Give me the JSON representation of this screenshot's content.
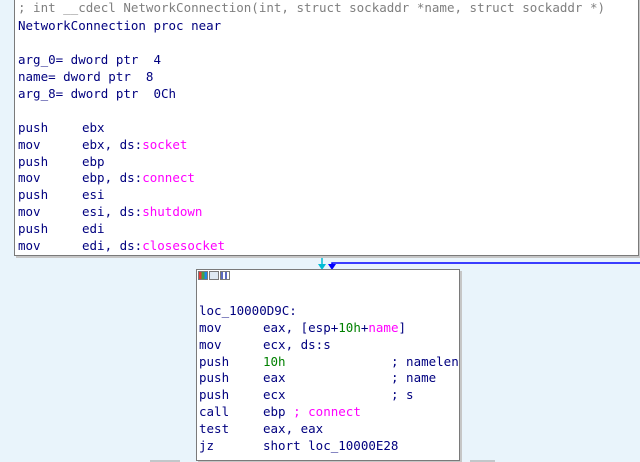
{
  "top_block": {
    "header_comment": "; int __cdecl NetworkConnection(int, struct sockaddr *name, struct sockaddr *)",
    "proc_line": "NetworkConnection proc near",
    "args": [
      "arg_0= dword ptr  4",
      "name= dword ptr  8",
      "arg_8= dword ptr  0Ch"
    ],
    "instructions": [
      {
        "mnemonic": "push",
        "op1": "ebx",
        "sep": "",
        "op2": ""
      },
      {
        "mnemonic": "mov",
        "op1": "ebx, ds:",
        "sep": "",
        "op2": "socket"
      },
      {
        "mnemonic": "push",
        "op1": "ebp",
        "sep": "",
        "op2": ""
      },
      {
        "mnemonic": "mov",
        "op1": "ebp, ds:",
        "sep": "",
        "op2": "connect"
      },
      {
        "mnemonic": "push",
        "op1": "esi",
        "sep": "",
        "op2": ""
      },
      {
        "mnemonic": "mov",
        "op1": "esi, ds:",
        "sep": "",
        "op2": "shutdown"
      },
      {
        "mnemonic": "push",
        "op1": "edi",
        "sep": "",
        "op2": ""
      },
      {
        "mnemonic": "mov",
        "op1": "edi, ds:",
        "sep": "",
        "op2": "closesocket"
      }
    ]
  },
  "bottom_block": {
    "label": "loc_10000D9C:",
    "lines": [
      {
        "mnemonic": "mov",
        "pre": "eax, [esp+",
        "num": "10h",
        "mid": "+",
        "name": "name",
        "post": "]",
        "comment": ""
      },
      {
        "mnemonic": "mov",
        "pre": "ecx, ds:s",
        "num": "",
        "mid": "",
        "name": "",
        "post": "",
        "comment": ""
      },
      {
        "mnemonic": "push",
        "pre": "",
        "num": "10h",
        "mid": "",
        "name": "",
        "post": "",
        "comment": "; namelen"
      },
      {
        "mnemonic": "push",
        "pre": "eax",
        "num": "",
        "mid": "",
        "name": "",
        "post": "",
        "comment": "; name"
      },
      {
        "mnemonic": "push",
        "pre": "ecx",
        "num": "",
        "mid": "",
        "name": "",
        "post": "",
        "comment": "; s"
      },
      {
        "mnemonic": "call",
        "pre": "ebp ",
        "num": "",
        "mid": "",
        "name": "",
        "post": "",
        "comment": "; connect"
      },
      {
        "mnemonic": "test",
        "pre": "eax, eax",
        "num": "",
        "mid": "",
        "name": "",
        "post": "",
        "comment": ""
      },
      {
        "mnemonic": "jz",
        "pre": "short loc_10000E28",
        "num": "",
        "mid": "",
        "name": "",
        "post": "",
        "comment": ""
      }
    ]
  },
  "colors": {
    "background": "#e9f4fb",
    "text": "#00007f",
    "import_name": "#ff00ff",
    "number": "#008000",
    "comment_gray": "#7f7f7f",
    "edge_blue": "#0000ff",
    "edge_cyan": "#00bcd4"
  }
}
